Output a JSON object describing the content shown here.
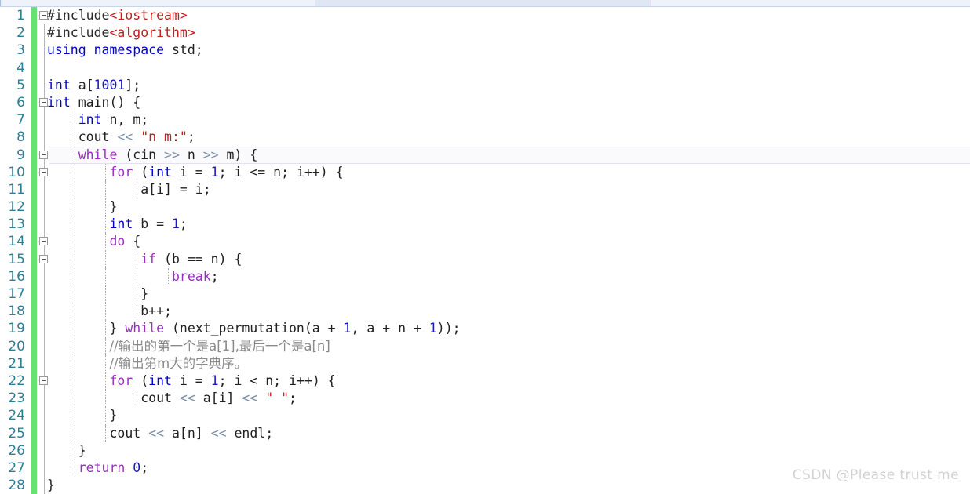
{
  "window": {
    "app": "C++ source code editor",
    "tab_bar_visible": true
  },
  "watermark": {
    "text": "CSDN @Please trust me"
  },
  "editor": {
    "language": "C++",
    "cursor_line": 9,
    "cursor_column": 26,
    "colors": {
      "background": "#ffffff",
      "line_number": "#2d7f94",
      "change_bar_green": "#68e173",
      "current_line_bg": "#fafafd",
      "current_line_border": "#e2e2ef",
      "keyword_blue": "#0000d0",
      "keyword_purple": "#9b2ec4",
      "string_red": "#c02020",
      "operator_grey": "#7a8fa8",
      "comment_grey": "#8a8a8a",
      "watermark": "#d2d2d2"
    },
    "lines": [
      {
        "n": 1,
        "fold": "open",
        "text": "#include<iostream>"
      },
      {
        "n": 2,
        "fold": "end",
        "text": "#include<algorithm>"
      },
      {
        "n": 3,
        "fold": "none",
        "text": "using namespace std;"
      },
      {
        "n": 4,
        "fold": "none",
        "text": ""
      },
      {
        "n": 5,
        "fold": "none",
        "text": "int a[1001];"
      },
      {
        "n": 6,
        "fold": "open",
        "text": "int main() {"
      },
      {
        "n": 7,
        "fold": "none",
        "text": "    int n, m;"
      },
      {
        "n": 8,
        "fold": "none",
        "text": "    cout << \"n m:\";"
      },
      {
        "n": 9,
        "fold": "open",
        "text": "    while (cin >> n >> m) {"
      },
      {
        "n": 10,
        "fold": "open",
        "text": "        for (int i = 1; i <= n; i++) {"
      },
      {
        "n": 11,
        "fold": "none",
        "text": "            a[i] = i;"
      },
      {
        "n": 12,
        "fold": "none",
        "text": "        }"
      },
      {
        "n": 13,
        "fold": "none",
        "text": "        int b = 1;"
      },
      {
        "n": 14,
        "fold": "open",
        "text": "        do {"
      },
      {
        "n": 15,
        "fold": "open",
        "text": "            if (b == n) {"
      },
      {
        "n": 16,
        "fold": "none",
        "text": "                break;"
      },
      {
        "n": 17,
        "fold": "none",
        "text": "            }"
      },
      {
        "n": 18,
        "fold": "none",
        "text": "            b++;"
      },
      {
        "n": 19,
        "fold": "none",
        "text": "        } while (next_permutation(a + 1, a + n + 1));"
      },
      {
        "n": 20,
        "fold": "none",
        "text": "        //输出的第一个是a[1],最后一个是a[n]"
      },
      {
        "n": 21,
        "fold": "none",
        "text": "        //输出第m大的字典序。"
      },
      {
        "n": 22,
        "fold": "open",
        "text": "        for (int i = 1; i < n; i++) {"
      },
      {
        "n": 23,
        "fold": "none",
        "text": "            cout << a[i] << \" \";"
      },
      {
        "n": 24,
        "fold": "none",
        "text": "        }"
      },
      {
        "n": 25,
        "fold": "none",
        "text": "        cout << a[n] << endl;"
      },
      {
        "n": 26,
        "fold": "none",
        "text": "    }"
      },
      {
        "n": 27,
        "fold": "none",
        "text": "    return 0;"
      },
      {
        "n": 28,
        "fold": "none",
        "text": "}"
      }
    ]
  }
}
